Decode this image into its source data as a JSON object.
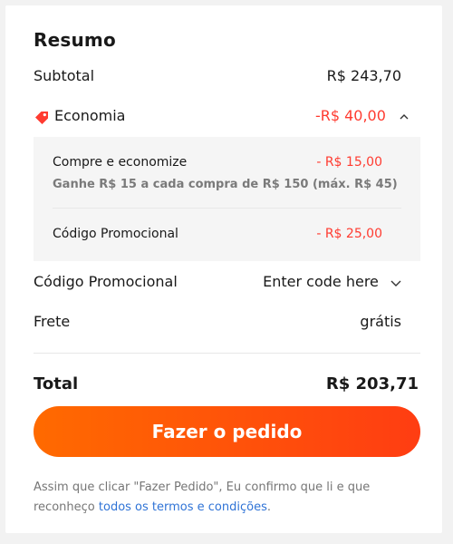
{
  "summary": {
    "title": "Resumo",
    "subtotal_label": "Subtotal",
    "subtotal_value": "R$ 243,70",
    "economy_label": "Economia",
    "economy_value": "-R$ 40,00",
    "economy_items": [
      {
        "label": "Compre e economize",
        "value": "- R$ 15,00",
        "note": "Ganhe R$ 15 a cada compra de R$ 150 (máx. R$ 45)"
      },
      {
        "label": "Código Promocional",
        "value": "- R$ 25,00"
      }
    ],
    "promo_label": "Código Promocional",
    "promo_placeholder": "Enter code here",
    "shipping_label": "Frete",
    "shipping_value": "grátis",
    "total_label": "Total",
    "total_value": "R$ 203,71"
  },
  "checkout": {
    "button_label": "Fazer o pedido"
  },
  "disclaimer": {
    "text": "Assim que clicar \"Fazer Pedido\", Eu confirmo que li e que reconheço",
    "link": "todos os termos e condições",
    "end": "."
  },
  "colors": {
    "accent": "#ff3b30",
    "button_start": "#ff6a00",
    "button_end": "#ff3d12",
    "link": "#2f73d6"
  },
  "icons": [
    "tag-icon",
    "chevron-up-icon",
    "chevron-down-icon"
  ]
}
